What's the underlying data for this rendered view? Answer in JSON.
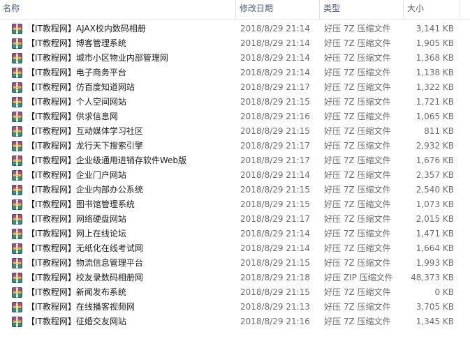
{
  "header": {
    "name": "名称",
    "date": "修改日期",
    "type": "类型",
    "size": "大小"
  },
  "files": [
    {
      "name": "【IT教程网】AJAX校内数码相册",
      "date": "2018/8/29 21:14",
      "type": "好压 7Z 压缩文件",
      "size": "3,141 KB"
    },
    {
      "name": "【IT教程网】博客管理系统",
      "date": "2018/8/29 21:14",
      "type": "好压 7Z 压缩文件",
      "size": "1,905 KB"
    },
    {
      "name": "【IT教程网】城市小区物业内部管理网",
      "date": "2018/8/29 21:14",
      "type": "好压 7Z 压缩文件",
      "size": "1,368 KB"
    },
    {
      "name": "【IT教程网】电子商务平台",
      "date": "2018/8/29 21:14",
      "type": "好压 7Z 压缩文件",
      "size": "1,138 KB"
    },
    {
      "name": "【IT教程网】仿百度知道网站",
      "date": "2018/8/29 21:17",
      "type": "好压 7Z 压缩文件",
      "size": "1,322 KB"
    },
    {
      "name": "【IT教程网】个人空间网站",
      "date": "2018/8/29 21:15",
      "type": "好压 7Z 压缩文件",
      "size": "1,721 KB"
    },
    {
      "name": "【IT教程网】供求信息网",
      "date": "2018/8/29 21:16",
      "type": "好压 7Z 压缩文件",
      "size": "1,065 KB"
    },
    {
      "name": "【IT教程网】互动媒体学习社区",
      "date": "2018/8/29 21:15",
      "type": "好压 7Z 压缩文件",
      "size": "811 KB"
    },
    {
      "name": "【IT教程网】龙行天下搜索引擎",
      "date": "2018/8/29 21:17",
      "type": "好压 7Z 压缩文件",
      "size": "2,932 KB"
    },
    {
      "name": "【IT教程网】企业级通用进销存软件Web版",
      "date": "2018/8/29 21:17",
      "type": "好压 7Z 压缩文件",
      "size": "1,676 KB"
    },
    {
      "name": "【IT教程网】企业门户网站",
      "date": "2018/8/29 21:14",
      "type": "好压 7Z 压缩文件",
      "size": "2,357 KB"
    },
    {
      "name": "【IT教程网】企业内部办公系统",
      "date": "2018/8/29 21:15",
      "type": "好压 7Z 压缩文件",
      "size": "2,540 KB"
    },
    {
      "name": "【IT教程网】图书馆管理系统",
      "date": "2018/8/29 21:15",
      "type": "好压 7Z 压缩文件",
      "size": "1,073 KB"
    },
    {
      "name": "【IT教程网】网络硬盘网站",
      "date": "2018/8/29 21:17",
      "type": "好压 7Z 压缩文件",
      "size": "2,015 KB"
    },
    {
      "name": "【IT教程网】网上在线论坛",
      "date": "2018/8/29 21:14",
      "type": "好压 7Z 压缩文件",
      "size": "1,471 KB"
    },
    {
      "name": "【IT教程网】无纸化在线考试网",
      "date": "2018/8/29 21:14",
      "type": "好压 7Z 压缩文件",
      "size": "1,664 KB"
    },
    {
      "name": "【IT教程网】物流信息管理平台",
      "date": "2018/8/29 21:15",
      "type": "好压 7Z 压缩文件",
      "size": "1,993 KB"
    },
    {
      "name": "【IT教程网】校友录数码相册网",
      "date": "2018/8/29 21:18",
      "type": "好压 ZIP 压缩文件",
      "size": "48,373 KB"
    },
    {
      "name": "【IT教程网】新闻发布系统",
      "date": "2018/8/29 21:15",
      "type": "好压 7Z 压缩文件",
      "size": "0 KB"
    },
    {
      "name": "【IT教程网】在线播客视频网",
      "date": "2018/8/29 21:13",
      "type": "好压 7Z 压缩文件",
      "size": "3,705 KB"
    },
    {
      "name": "【IT教程网】征婚交友网站",
      "date": "2018/8/29 21:16",
      "type": "好压 7Z 压缩文件",
      "size": "1,345 KB"
    }
  ]
}
